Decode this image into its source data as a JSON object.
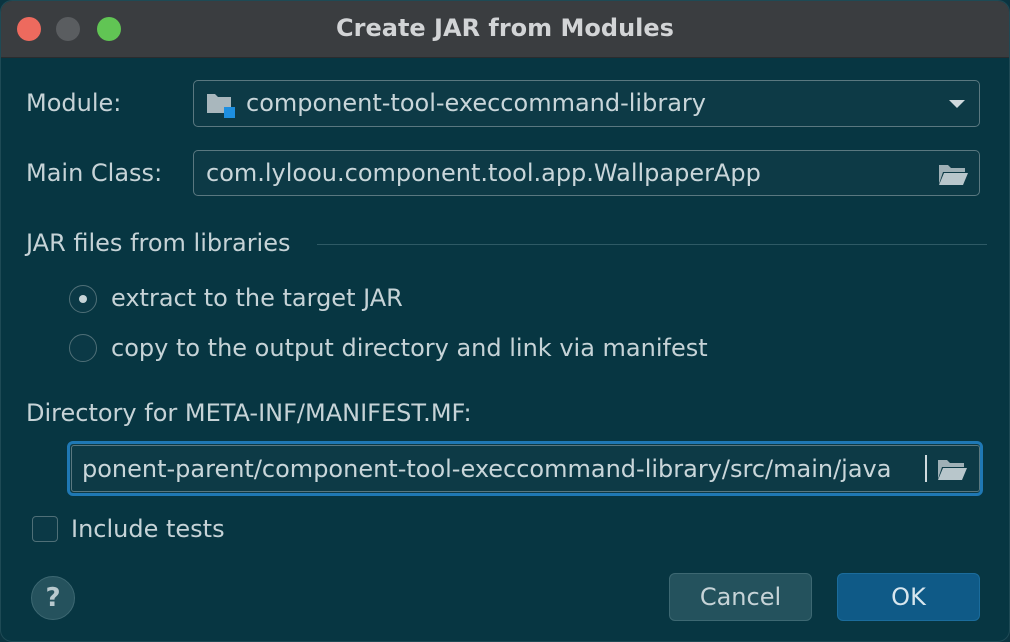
{
  "window": {
    "title": "Create JAR from Modules"
  },
  "module": {
    "label": "Module:",
    "value": "component-tool-execcommand-library"
  },
  "main_class": {
    "label": "Main Class:",
    "value": "com.lyloou.component.tool.app.WallpaperApp"
  },
  "jar_files": {
    "section_label": "JAR files from libraries",
    "options": [
      {
        "label": "extract to the target JAR",
        "selected": true
      },
      {
        "label": "copy to the output directory and link via manifest",
        "selected": false
      }
    ]
  },
  "manifest": {
    "label": "Directory for META-INF/MANIFEST.MF:",
    "value": "ponent-parent/component-tool-execcommand-library/src/main/java"
  },
  "include_tests": {
    "label": "Include tests",
    "checked": false
  },
  "buttons": {
    "help": "?",
    "cancel": "Cancel",
    "ok": "OK"
  },
  "colors": {
    "background": "#073642",
    "titlebar": "#3a3d40",
    "primary_button": "#0f5a87",
    "focus_border": "#1f78b4",
    "close": "#ed6a5e",
    "maximize": "#61c554"
  }
}
